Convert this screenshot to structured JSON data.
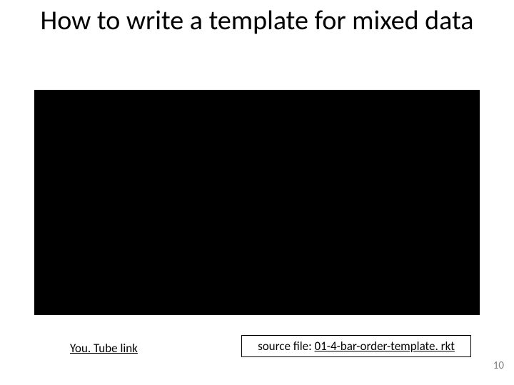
{
  "title": "How to write a template for mixed data",
  "youtube_link_label": "You. Tube link",
  "source_file_prefix": "source file: ",
  "source_file_name": "01-4-bar-order-template. rkt",
  "page_number": "10"
}
